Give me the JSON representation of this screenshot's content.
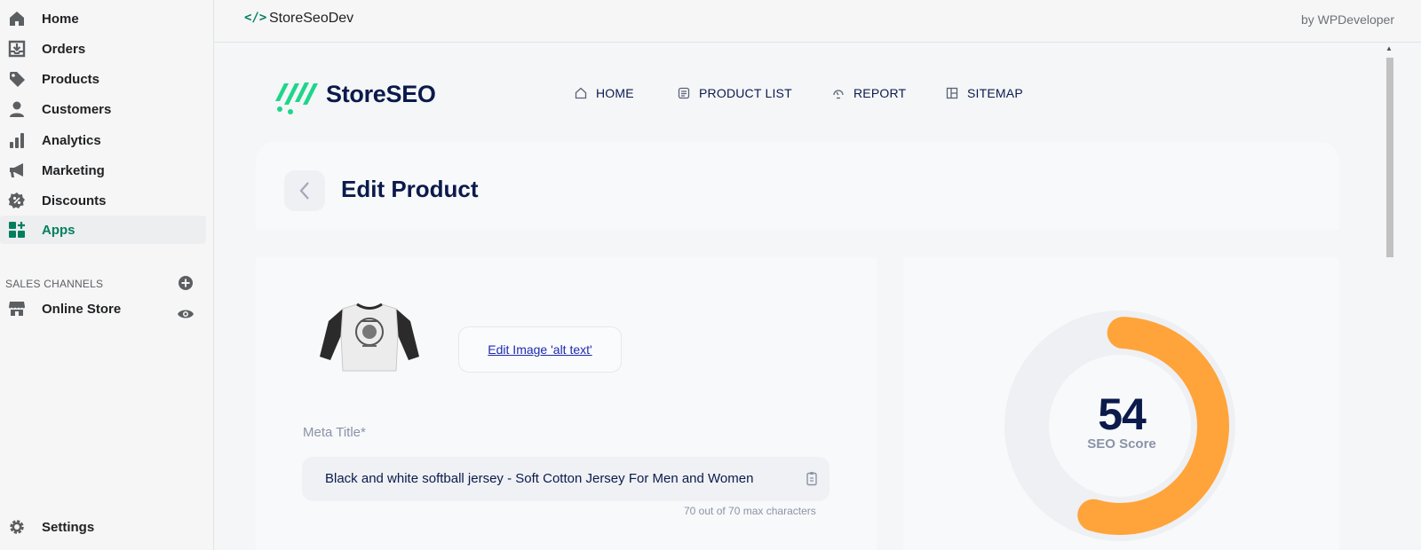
{
  "sidebar": {
    "items": [
      {
        "label": "Home",
        "icon": "home-icon"
      },
      {
        "label": "Orders",
        "icon": "orders-icon"
      },
      {
        "label": "Products",
        "icon": "tag-icon"
      },
      {
        "label": "Customers",
        "icon": "person-icon"
      },
      {
        "label": "Analytics",
        "icon": "bar-chart-icon"
      },
      {
        "label": "Marketing",
        "icon": "megaphone-icon"
      },
      {
        "label": "Discounts",
        "icon": "discount-icon"
      },
      {
        "label": "Apps",
        "icon": "apps-icon",
        "active": true
      }
    ],
    "sales_channels_title": "SALES CHANNELS",
    "online_store": "Online Store",
    "settings": "Settings"
  },
  "appbar": {
    "app_name": "StoreSeoDev",
    "by": "by WPDeveloper"
  },
  "brand": {
    "name": "StoreSEO",
    "color": "#1ed68a"
  },
  "topnav": {
    "home": "HOME",
    "product_list": "PRODUCT LIST",
    "report": "REPORT",
    "sitemap": "SITEMAP"
  },
  "page": {
    "title": "Edit Product"
  },
  "product": {
    "alt_text_button": "Edit Image 'alt text'",
    "meta_title_label": "Meta Title*",
    "meta_title_value": "Black and white softball jersey - Soft Cotton Jersey For Men and Women",
    "char_count": "70 out of 70 max characters"
  },
  "seo": {
    "score": "54",
    "score_fraction": 0.54,
    "label": "SEO Score",
    "ring_color": "#ffa43a",
    "track_color": "#eef0f3"
  },
  "colors": {
    "accent": "#008060",
    "navy": "#0b1a4b",
    "link": "#1c2baf"
  }
}
